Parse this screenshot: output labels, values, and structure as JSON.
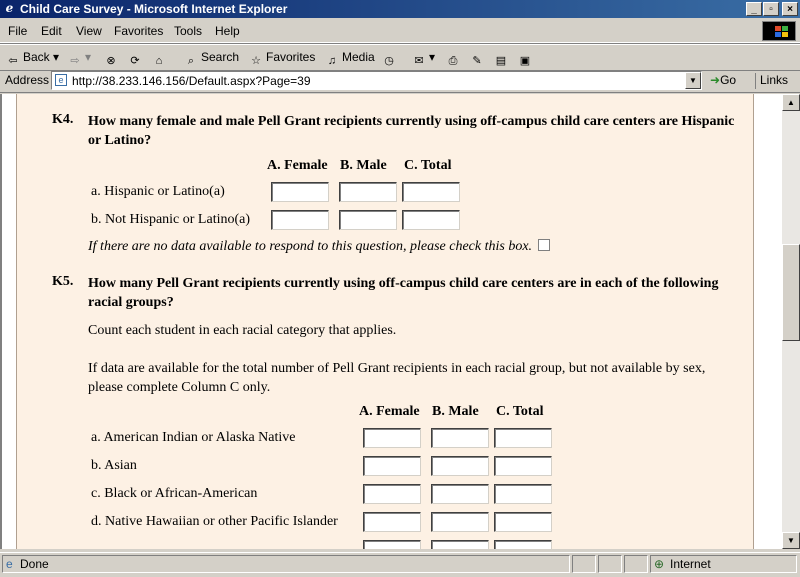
{
  "window": {
    "title": "Child Care Survey - Microsoft Internet Explorer",
    "controls": {
      "minimize": "_",
      "maximize": "▫",
      "close": "×"
    }
  },
  "menu": [
    "File",
    "Edit",
    "View",
    "Favorites",
    "Tools",
    "Help"
  ],
  "toolbar": {
    "back": "Back",
    "search": "Search",
    "favorites": "Favorites",
    "media": "Media"
  },
  "address": {
    "label": "Address",
    "url": "http://38.233.146.156/Default.aspx?Page=39",
    "go": "Go",
    "links": "Links"
  },
  "k4": {
    "number": "K4.",
    "question": "How many female and male Pell Grant recipients currently using off-campus child care centers are Hispanic or Latino?",
    "col_female": "A. Female",
    "col_male": "B. Male",
    "col_total": "C. Total",
    "rows": [
      "a. Hispanic or Latino(a)",
      "b. Not Hispanic or Latino(a)"
    ],
    "no_data": "If there are no data available to respond to this question, please check this box."
  },
  "k5": {
    "number": "K5.",
    "question": "How many Pell Grant recipients currently using off-campus child care centers are in each of the following racial groups?",
    "instruction1": "Count each student in each racial category that applies.",
    "instruction2": "If data are available for the total number of Pell Grant recipients in each racial group, but not available by sex, please complete Column C only.",
    "col_female": "A. Female",
    "col_male": "B. Male",
    "col_total": "C. Total",
    "rows": [
      "a. American Indian or Alaska Native",
      "b. Asian",
      "c. Black or African-American",
      "d. Native Hawaiian or other Pacific Islander"
    ]
  },
  "status": {
    "text": "Done",
    "zone": "Internet"
  }
}
